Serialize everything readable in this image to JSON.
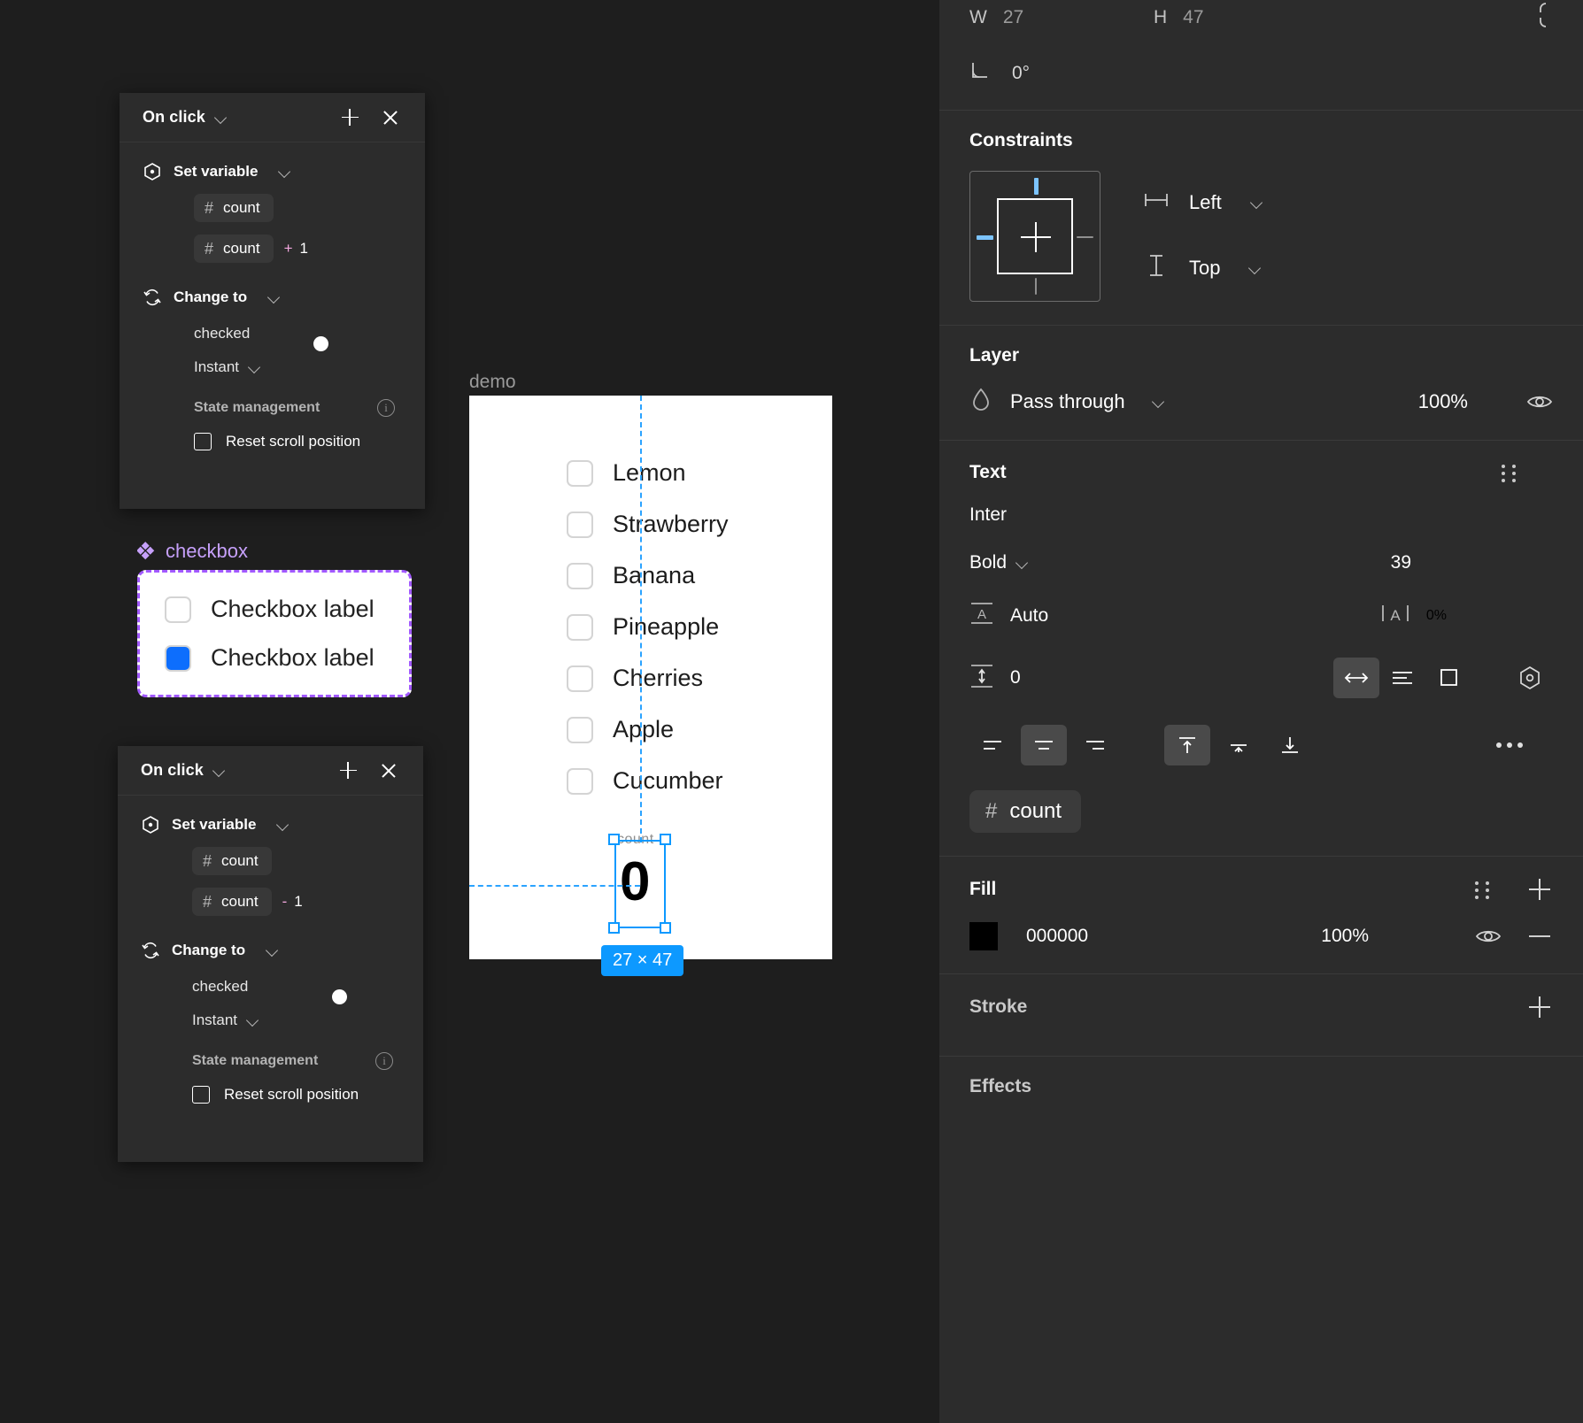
{
  "interactions": [
    {
      "trigger": "On click",
      "action": "Set variable",
      "variable_chip": "count",
      "expression_chip": "count",
      "operator": "+",
      "operand": "1",
      "change_action": "Change to",
      "property_name": "checked",
      "toggle_state": "on",
      "easing": "Instant",
      "state_management_title": "State management",
      "reset_scroll_label": "Reset scroll position"
    },
    {
      "trigger": "On click",
      "action": "Set variable",
      "variable_chip": "count",
      "expression_chip": "count",
      "operator": "-",
      "operand": "1",
      "change_action": "Change to",
      "property_name": "checked",
      "toggle_state": "off",
      "easing": "Instant",
      "state_management_title": "State management",
      "reset_scroll_label": "Reset scroll position"
    }
  ],
  "component": {
    "name": "checkbox",
    "rows": [
      {
        "label": "Checkbox label",
        "checked": false
      },
      {
        "label": "Checkbox label",
        "checked": true
      }
    ],
    "checked_color": "#0d6efd",
    "outline_color": "#a259ff"
  },
  "canvas": {
    "frame_name": "demo",
    "fruits": [
      "Lemon",
      "Strawberry",
      "Banana",
      "Pineapple",
      "Cherries",
      "Apple",
      "Cucumber"
    ],
    "count_label": "count",
    "count_value": "0",
    "selection_size": "27 × 47",
    "selection_color": "#0d99ff"
  },
  "inspector": {
    "dimensions": {
      "w_key": "W",
      "w_val": "27",
      "h_key": "H",
      "h_val": "47",
      "rotation": "0°"
    },
    "constraints": {
      "title": "Constraints",
      "horizontal": "Left",
      "vertical": "Top"
    },
    "layer": {
      "title": "Layer",
      "blend_mode": "Pass through",
      "opacity": "100%"
    },
    "text": {
      "title": "Text",
      "font_family": "Inter",
      "font_weight": "Bold",
      "font_size": "39",
      "line_height": "Auto",
      "letter_spacing": "0%",
      "paragraph_spacing": "0",
      "variable_chip": "count"
    },
    "fill": {
      "title": "Fill",
      "hex": "000000",
      "opacity": "100%",
      "color": "#000000"
    },
    "stroke": {
      "title": "Stroke"
    },
    "effects": {
      "title": "Effects"
    }
  }
}
